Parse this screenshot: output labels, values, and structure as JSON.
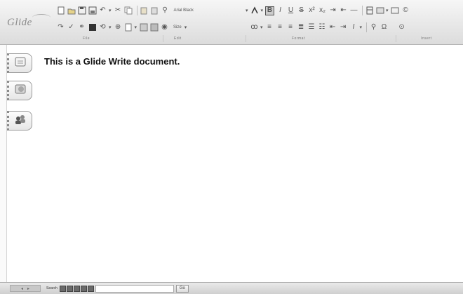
{
  "app": {
    "logo_text": "Glide"
  },
  "toolbar": {
    "font_name": "Arial Black",
    "font_size": "Size",
    "groups": [
      "File",
      "Edit",
      "Format",
      "Insert"
    ]
  },
  "sidebar": {
    "items": [
      {
        "name": "documents",
        "icon": "document-icon"
      },
      {
        "name": "image",
        "icon": "image-icon"
      },
      {
        "name": "people",
        "icon": "people-icon"
      }
    ]
  },
  "document": {
    "text": "This is a Glide Write document."
  },
  "statusbar": {
    "search_label": "Search",
    "search_value": "",
    "go_label": "Go"
  }
}
